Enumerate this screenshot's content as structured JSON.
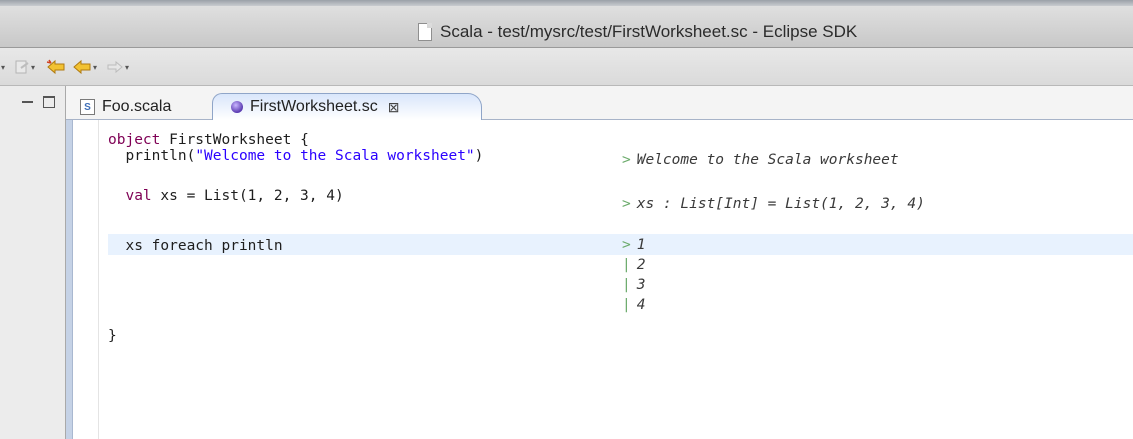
{
  "window": {
    "title": "Scala - test/mysrc/test/FirstWorksheet.sc - Eclipse SDK"
  },
  "tabs": [
    {
      "label": "Foo.scala",
      "icon": "scala-file-icon",
      "active": false
    },
    {
      "label": "FirstWorksheet.sc",
      "icon": "worksheet-icon",
      "active": true,
      "close": "⊠"
    }
  ],
  "code": {
    "line1": {
      "kw": "object",
      "rest": " FirstWorksheet {"
    },
    "line2": {
      "pre": "  println(",
      "str": "\"Welcome to the Scala worksheet\"",
      "post": ")"
    },
    "line3": {
      "kw": "  val",
      "rest": " xs = List(1, 2, 3, 4)"
    },
    "line4": "  xs foreach println",
    "line5": "}"
  },
  "output": [
    {
      "mark": ">",
      "text": "Welcome to the Scala worksheet"
    },
    {
      "mark": ">",
      "text": "xs : List[Int] = List(1, 2, 3, 4)"
    },
    {
      "mark": ">",
      "text": "1"
    },
    {
      "mark": "|",
      "text": "2"
    },
    {
      "mark": "|",
      "text": "3"
    },
    {
      "mark": "|",
      "text": "4"
    }
  ],
  "colors": {
    "keyword": "#7f0055",
    "string": "#2a00ff",
    "output_marker": "#6bab6b",
    "current_line": "#e8f2fe"
  }
}
